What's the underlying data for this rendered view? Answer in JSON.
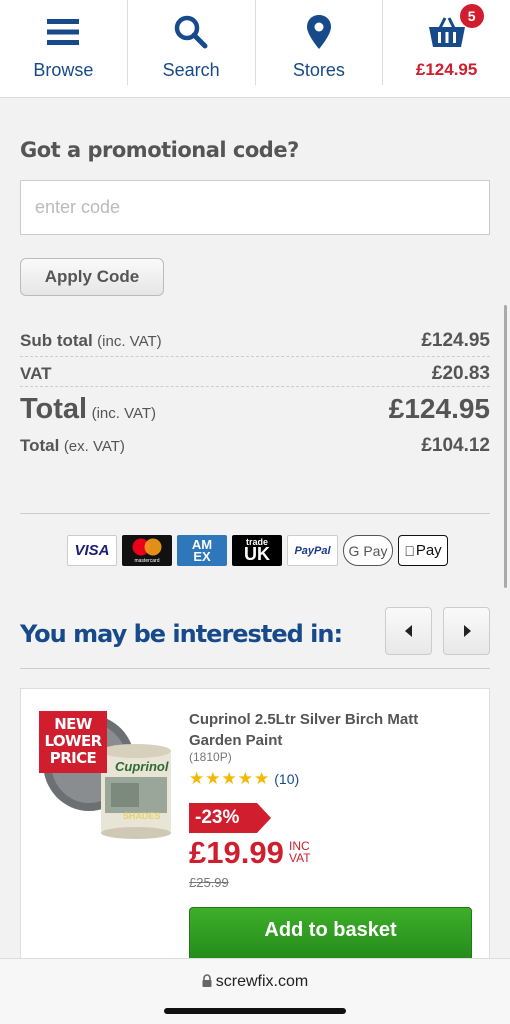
{
  "nav": {
    "browse": "Browse",
    "search": "Search",
    "stores": "Stores",
    "basket_total": "£124.95",
    "basket_count": "5"
  },
  "promo": {
    "heading": "Got a promotional code?",
    "placeholder": "enter code",
    "apply_label": "Apply Code"
  },
  "totals": {
    "subtotal_label": "Sub total",
    "subtotal_note": "(inc. VAT)",
    "subtotal_value": "£124.95",
    "vat_label": "VAT",
    "vat_value": "£20.83",
    "total_label": "Total",
    "total_note": "(inc. VAT)",
    "total_value": "£124.95",
    "total_ex_label": "Total",
    "total_ex_note": "(ex. VAT)",
    "total_ex_value": "£104.12"
  },
  "payments": {
    "visa": "VISA",
    "mastercard": "mastercard",
    "amex_top": "AM",
    "amex_bottom": "EX",
    "trade_uk_top": "trade",
    "trade_uk_bottom": "UK",
    "paypal": "PayPal",
    "gpay": "G Pay",
    "apple_pay": "Pay"
  },
  "interest": {
    "title": "You may be interested in:"
  },
  "product": {
    "tag_line1": "NEW",
    "tag_line2": "LOWER",
    "tag_line3": "PRICE",
    "title": "Cuprinol 2.5Ltr Silver Birch Matt Garden Paint",
    "code": "(1810P)",
    "rating": 5,
    "reviews": "(10)",
    "discount": "-23%",
    "price": "£19.99",
    "inc": "INC",
    "vat": "VAT",
    "was_price": "£25.99",
    "add_label": "Add to basket",
    "brand": "Cuprinol",
    "shades": "SHADES"
  },
  "browser": {
    "url": "screwfix.com"
  },
  "colors": {
    "brand_blue": "#174a8b",
    "price_red": "#d01e2e",
    "add_green": "#2e9c22"
  }
}
